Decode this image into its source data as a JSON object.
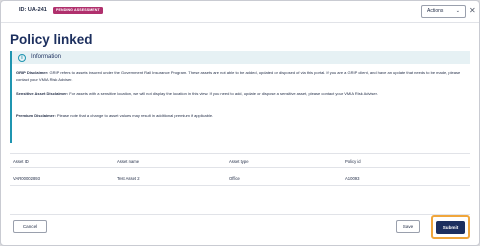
{
  "header": {
    "id_label": "ID: UA-241",
    "status_badge": "PENDING ASSESSMENT",
    "actions_label": "Actions",
    "close_glyph": "✕",
    "chevron_glyph": "⌄"
  },
  "page": {
    "title": "Policy linked"
  },
  "info": {
    "icon_glyph": "i",
    "title": "Information",
    "grip": {
      "label": "GRIP Disclaimer:",
      "text": " GRIP refers to assets insured under the Government Rail Insurance Program. These assets are not able to be added, updated or disposed of via this portal. If you are a GRIP client, and have an update that needs to be made, please contact your VMIA Risk Adviser."
    },
    "sensitive": {
      "label": "Sensitive Asset Disclaimer:",
      "text": " For assets with a sensitive location, we will not display the location in this view. If you need to add, update or dispose a sensitive asset, please contact your VMIA Risk Adviser."
    },
    "premium": {
      "label": "Premium Disclaimer:",
      "text": " Please note that a change to asset values may result in additional premium if applicable."
    }
  },
  "table": {
    "columns": [
      "Asset ID",
      "Asset name",
      "Asset type",
      "Policy id"
    ],
    "rows": [
      [
        "VAR00002893",
        "Test Asset 2",
        "Office",
        "A10093"
      ]
    ]
  },
  "footer": {
    "cancel_label": "Cancel",
    "save_label": "Save",
    "submit_label": "Submit"
  },
  "colors": {
    "brand_navy": "#1c2f5e",
    "badge_magenta": "#b0306d",
    "info_teal": "#1f95b0",
    "highlight_orange": "#f0a63c"
  }
}
